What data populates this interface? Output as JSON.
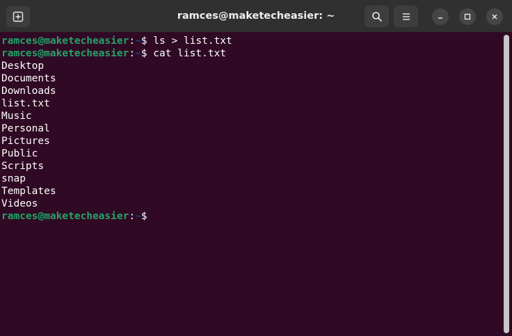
{
  "window": {
    "title": "ramces@maketecheasier: ~"
  },
  "titlebar": {
    "buttons": [
      "new-tab-icon",
      "search-icon",
      "hamburger-menu-icon",
      "minimize-icon",
      "maximize-icon",
      "close-icon"
    ]
  },
  "colors": {
    "background": "#300a24",
    "titlebar": "#303030",
    "prompt_user": "#26a269",
    "prompt_path": "#12488b",
    "text": "#ffffff",
    "scrollbar": "#c7c7c7"
  },
  "terminal": {
    "prompt": {
      "user_host": "ramces@maketecheasier",
      "separator": ":",
      "path": "~",
      "symbol": "$"
    },
    "commands": [
      "ls > list.txt",
      "cat list.txt"
    ],
    "output": [
      "Desktop",
      "Documents",
      "Downloads",
      "list.txt",
      "Music",
      "Personal",
      "Pictures",
      "Public",
      "Scripts",
      "snap",
      "Templates",
      "Videos"
    ]
  }
}
